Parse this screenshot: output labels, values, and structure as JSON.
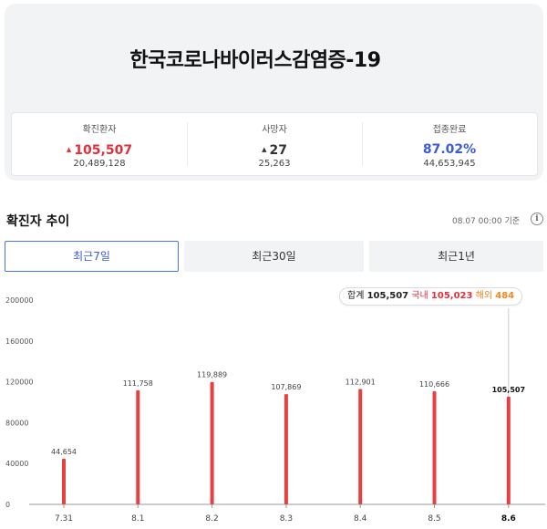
{
  "card": {
    "title": "한국코로나바이러스감염증-19"
  },
  "stats": [
    {
      "label": "확진환자",
      "value": "105,507",
      "arrow": "▲",
      "sub": "20,489,128",
      "color": "#e0313b"
    },
    {
      "label": "사망자",
      "value": "27",
      "arrow": "▲",
      "sub": "25,263",
      "color": "#333333"
    },
    {
      "label": "접종완료",
      "value": "87.02%",
      "arrow": "",
      "sub": "44,653,945",
      "color": "#3b5bd9"
    }
  ],
  "section": {
    "title": "확진자 추이",
    "updated": "08.07 00:00 기준",
    "info_icon": "info-icon"
  },
  "tabs": [
    {
      "label": "최근7일",
      "active": true
    },
    {
      "label": "최근30일",
      "active": false
    },
    {
      "label": "최근1년",
      "active": false
    }
  ],
  "tooltip": {
    "total_label": "합계",
    "total": "105,507",
    "domestic_label": "국내",
    "domestic": "105,023",
    "overseas_label": "해외",
    "overseas": "484"
  },
  "chart_data": {
    "type": "bar",
    "categories": [
      "7.31",
      "8.1",
      "8.2",
      "8.3",
      "8.4",
      "8.5",
      "8.6"
    ],
    "values": [
      44654,
      111758,
      119889,
      107869,
      112901,
      110666,
      105507
    ],
    "value_labels": [
      "44,654",
      "111,758",
      "119,889",
      "107,869",
      "112,901",
      "110,666",
      "105,507"
    ],
    "y_ticks": [
      0,
      40000,
      80000,
      120000,
      160000,
      200000
    ],
    "ylim": [
      0,
      200000
    ],
    "highlight_index": 6,
    "bar_color": "#e84040",
    "grid": false
  }
}
